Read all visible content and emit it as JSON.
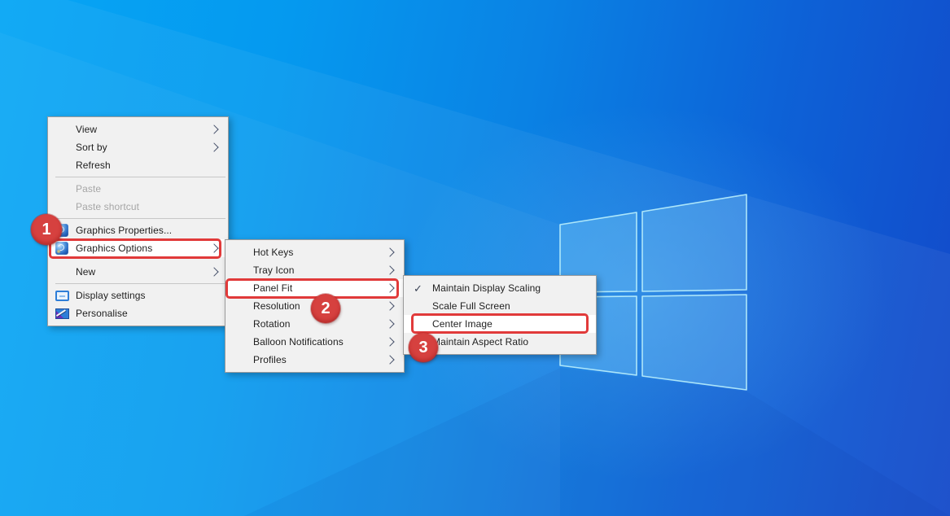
{
  "annotations": {
    "highlight_color": "#e13a3a",
    "badge_color": "#d6413f",
    "badges": [
      {
        "label": "1",
        "target": "Graphics Options"
      },
      {
        "label": "2",
        "target": "Panel Fit"
      },
      {
        "label": "3",
        "target": "Center Image"
      }
    ]
  },
  "context_menu": {
    "items": [
      {
        "label": "View",
        "arrow": true
      },
      {
        "label": "Sort by",
        "arrow": true
      },
      {
        "label": "Refresh"
      },
      {
        "type": "separator"
      },
      {
        "label": "Paste",
        "disabled": true
      },
      {
        "label": "Paste shortcut",
        "disabled": true
      },
      {
        "type": "separator"
      },
      {
        "label": "Graphics Properties...",
        "icon": "intel-graphics-icon"
      },
      {
        "label": "Graphics Options",
        "icon": "intel-graphics-icon",
        "arrow": true,
        "highlighted": true
      },
      {
        "type": "spacer"
      },
      {
        "label": "New",
        "arrow": true
      },
      {
        "type": "separator"
      },
      {
        "label": "Display settings",
        "icon": "display-icon"
      },
      {
        "label": "Personalise",
        "icon": "personalise-icon"
      }
    ]
  },
  "graphics_options_submenu": {
    "items": [
      {
        "label": "Hot Keys",
        "arrow": true
      },
      {
        "label": "Tray Icon",
        "arrow": true
      },
      {
        "label": "Panel Fit",
        "arrow": true,
        "highlighted": true
      },
      {
        "label": "Resolution",
        "arrow": true
      },
      {
        "label": "Rotation",
        "arrow": true
      },
      {
        "label": "Balloon Notifications",
        "arrow": true
      },
      {
        "label": "Profiles",
        "arrow": true
      }
    ]
  },
  "panel_fit_submenu": {
    "items": [
      {
        "label": "Maintain Display Scaling",
        "checked": true
      },
      {
        "label": "Scale Full Screen"
      },
      {
        "label": "Center Image",
        "highlighted": true
      },
      {
        "label": "Maintain Aspect Ratio"
      }
    ]
  },
  "wallpaper": {
    "colors": {
      "left": "#06a6f5",
      "mid": "#0a82e4",
      "right": "#1349c9",
      "logo_edge": "#b5ecfb"
    }
  }
}
